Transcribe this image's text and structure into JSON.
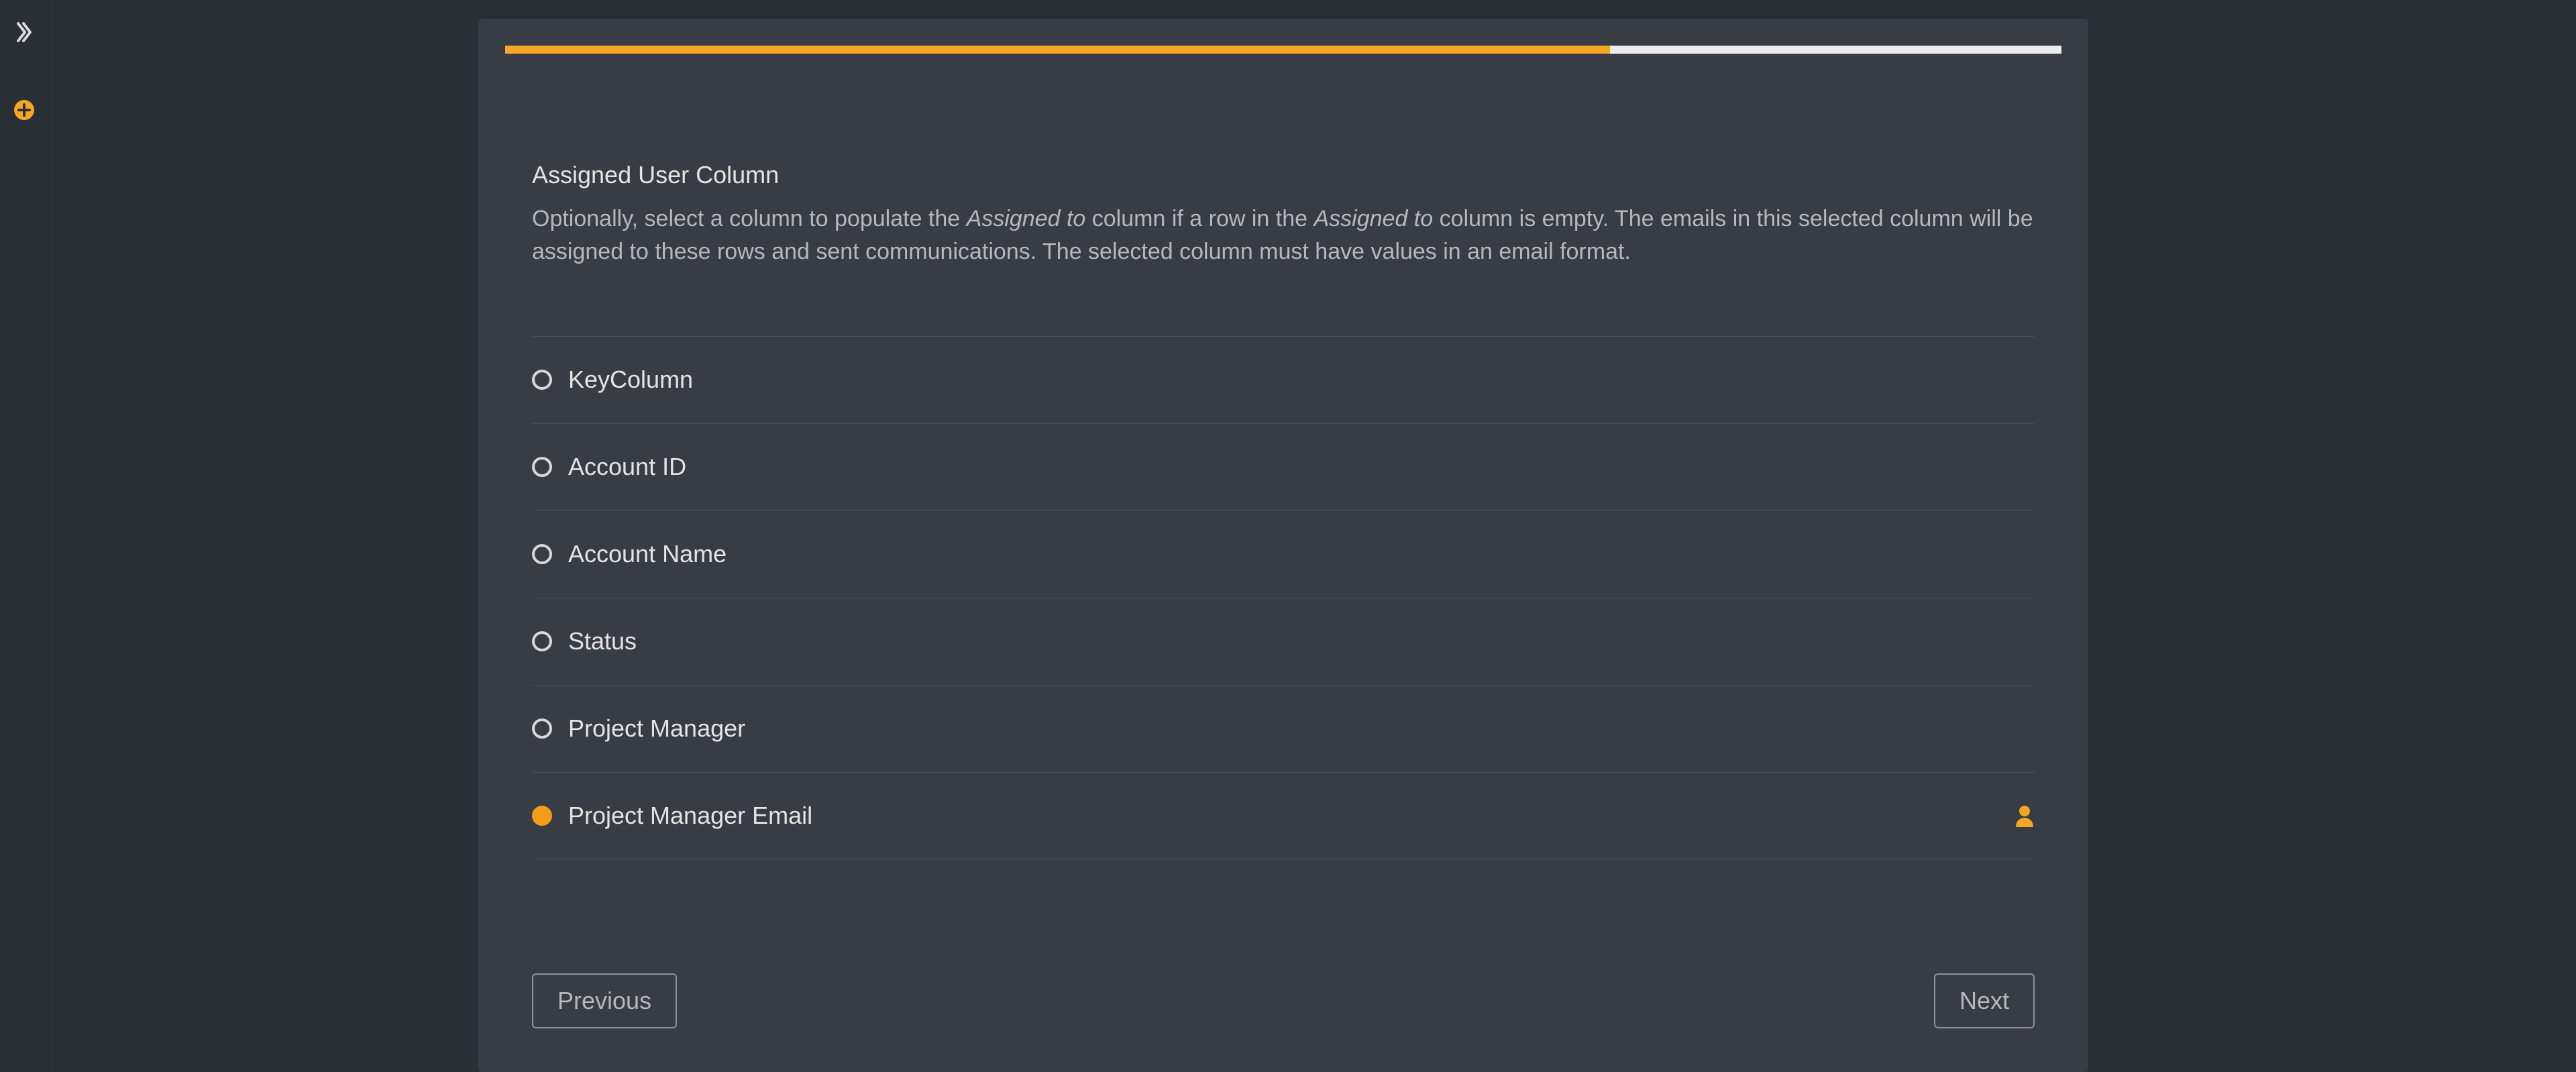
{
  "rail": {
    "expand_icon": "expand-sidebar-icon",
    "add_icon": "add-icon"
  },
  "progress": {
    "percent": 71
  },
  "section": {
    "title": "Assigned User Column",
    "desc_parts": [
      "Optionally, select a column to populate the ",
      "Assigned to",
      " column if a row in the ",
      "Assigned to",
      " column is empty. The emails in this selected column will be assigned to these rows and sent communications. The selected column must have values in an email format."
    ]
  },
  "options": [
    {
      "label": "KeyColumn",
      "selected": false
    },
    {
      "label": "Account ID",
      "selected": false
    },
    {
      "label": "Account Name",
      "selected": false
    },
    {
      "label": "Status",
      "selected": false
    },
    {
      "label": "Project Manager",
      "selected": false
    },
    {
      "label": "Project Manager Email",
      "selected": true,
      "trailing_icon": "user-icon"
    }
  ],
  "footer": {
    "previous": "Previous",
    "next": "Next"
  },
  "colors": {
    "accent": "#f5a623"
  }
}
